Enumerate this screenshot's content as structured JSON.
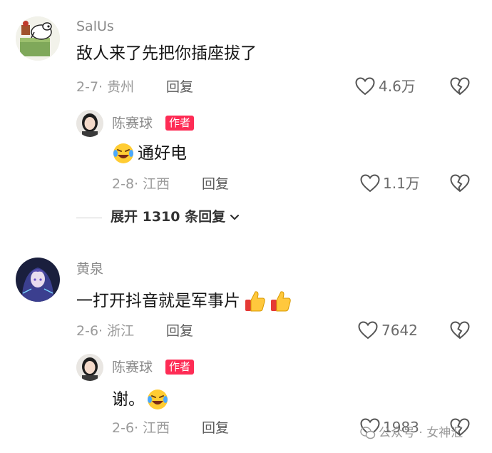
{
  "comments": [
    {
      "username": "SalUs",
      "text": "敌人来了先把你插座拔了",
      "date_location": "2-7· 贵州",
      "reply_label": "回复",
      "like_count": "4.6万",
      "author_reply": {
        "username": "陈赛球",
        "badge": "作者",
        "text": "通好电",
        "date_location": "2-8· 江西",
        "reply_label": "回复",
        "like_count": "1.1万"
      },
      "expand_label": "展开 1310 条回复"
    },
    {
      "username": "黄泉",
      "text": "一打开抖音就是军事片",
      "date_location": "2-6· 浙江",
      "reply_label": "回复",
      "like_count": "7642",
      "author_reply": {
        "username": "陈赛球",
        "badge": "作者",
        "text": "谢。",
        "date_location": "2-6· 江西",
        "reply_label": "回复",
        "like_count": "1983"
      }
    }
  ],
  "watermark": "公众号 · 女神汇",
  "icons": {
    "like": "heart-outline-icon",
    "dislike": "broken-heart-icon",
    "emoji_cry_laugh": "crying-laughing-emoji-icon",
    "emoji_thumbs_up": "thumbs-up-emoji-icon",
    "expand": "chevron-down-icon"
  },
  "colors": {
    "author_badge": "#fe2c55",
    "meta_text": "#9a9a9a",
    "content_text": "#161616"
  }
}
